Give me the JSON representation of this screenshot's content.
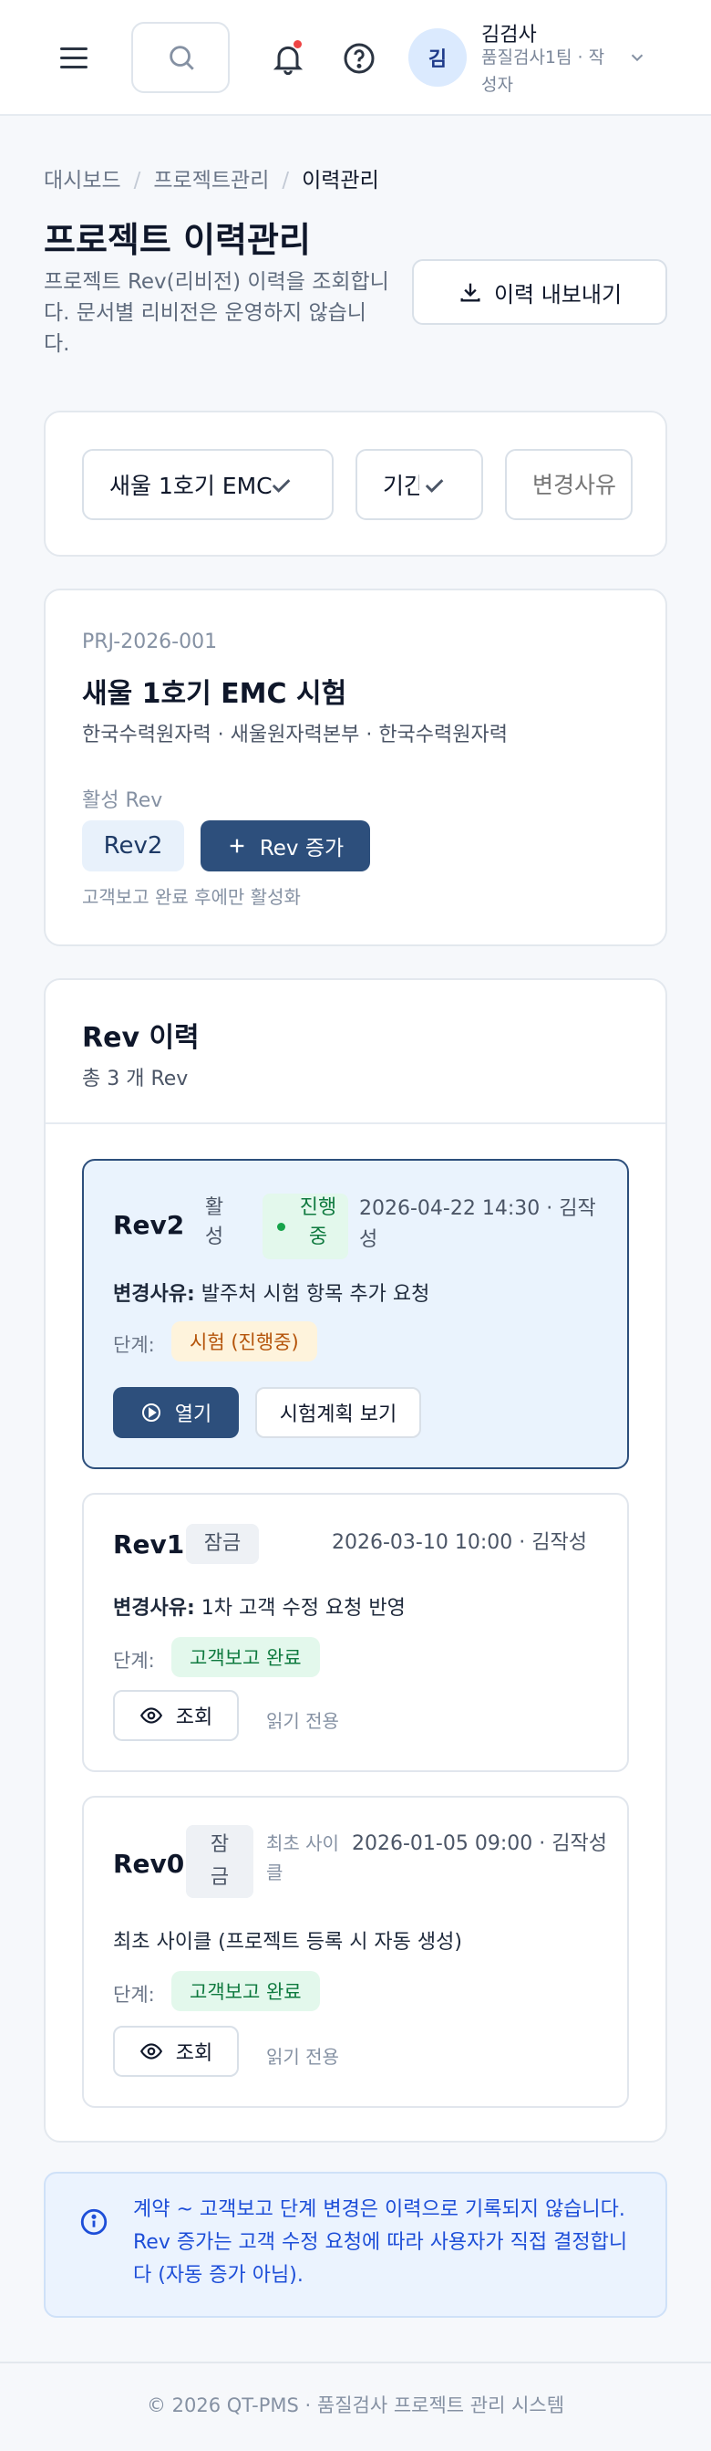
{
  "header": {
    "user_avatar": "김",
    "user_name": "김검사",
    "user_role": "품질검사1팀 · 작성자",
    "icons": [
      "menu-icon",
      "search-icon",
      "bell-icon",
      "help-icon",
      "chevron-down-icon"
    ],
    "notification_dot_color": "#ef4444"
  },
  "breadcrumb": {
    "items": [
      "대시보드",
      "프로젝트관리",
      "이력관리"
    ],
    "separator": "/"
  },
  "page": {
    "title": "프로젝트 이력관리",
    "description": "프로젝트 Rev(리비전) 이력을 조회합니다. 문서별 리비전은 운영하지 않습니다.",
    "export_label": "이력 내보내기"
  },
  "filters": {
    "project_value": "새울 1호기 EMC",
    "period_value": "기간",
    "changer_placeholder": "변경사유"
  },
  "project": {
    "code": "PRJ-2026-001",
    "name": "새울 1호기 EMC 시험",
    "orgs": "한국수력원자력 · 새울원자력본부 · 한국수력원자력",
    "active_label": "활성 Rev",
    "active_rev": "Rev2",
    "add_rev_label": "Rev 증가",
    "hint": "고객보고 완료 후에만 활성화"
  },
  "history": {
    "title": "Rev 이력",
    "count": "총 3 개 Rev",
    "items": [
      {
        "rev": "Rev2",
        "state": "활성",
        "status": "진행중",
        "meta": "2026-04-22 14:30 · 김작성",
        "reason_label": "변경사유:",
        "reason": " 발주처 시험 항목 추가 요청",
        "stage_label": "단계:",
        "stage": "시험 (진행중)",
        "open_label": "열기",
        "plan_label": "시험계획 보기"
      },
      {
        "rev": "Rev1",
        "state": "잠금",
        "meta": "2026-03-10 10:00 · 김작성",
        "reason_label": "변경사유:",
        "reason": " 1차 고객 수정 요청 반영",
        "stage_label": "단계:",
        "stage": "고객보고 완료",
        "view_label": "조회",
        "readonly": "읽기 전용"
      },
      {
        "rev": "Rev0",
        "state": "잠금",
        "cycle": "최초 사이클",
        "meta": "2026-01-05 09:00 · 김작성",
        "reason": "최초 사이클 (프로젝트 등록 시 자동 생성)",
        "stage_label": "단계:",
        "stage": "고객보고 완료",
        "view_label": "조회",
        "readonly": "읽기 전용"
      }
    ]
  },
  "info": {
    "text": "계약 ~ 고객보고 단계 변경은 이력으로 기록되지 않습니다. Rev 증가는 고객 수정 요청에 따라 사용자가 직접 결정합니다 (자동 증가 아님)."
  },
  "footer": {
    "text": "© 2026 QT-PMS · 품질검사 프로젝트 관리 시스템"
  },
  "colors": {
    "primary": "#2d4f7c",
    "active_bg": "#eaf3fd",
    "progress_badge": "#fef3dc",
    "done_badge": "#e3f8ec",
    "info_text": "#1d4ed8"
  }
}
